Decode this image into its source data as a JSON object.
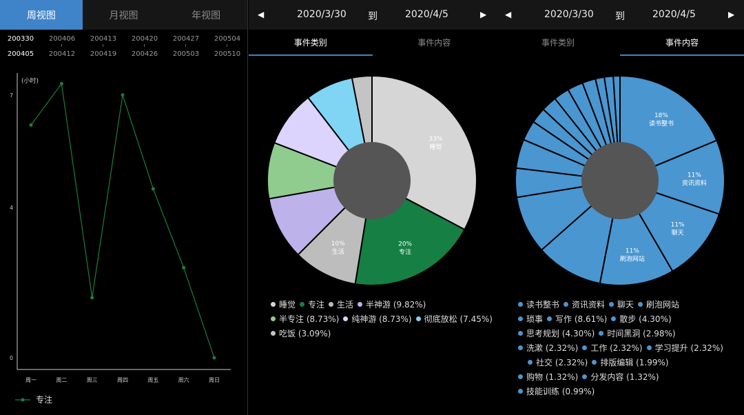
{
  "view_tabs": [
    "周视图",
    "月视图",
    "年视图"
  ],
  "weeks": [
    {
      "a": "200330",
      "b": "200405",
      "selected": true
    },
    {
      "a": "200406",
      "b": "200412"
    },
    {
      "a": "200413",
      "b": "200419"
    },
    {
      "a": "200420",
      "b": "200426"
    },
    {
      "a": "200427",
      "b": "200503"
    },
    {
      "a": "200504",
      "b": "200510"
    }
  ],
  "range": {
    "start": "2020/3/30",
    "to": "到",
    "end": "2020/4/5"
  },
  "sub_tabs": [
    "事件类别",
    "事件内容"
  ],
  "colors": {
    "accent": "#3f83c8",
    "focus": "#1a7f3f",
    "blue": "#4a96d0"
  },
  "chart_data": [
    {
      "type": "line",
      "ylabel": "(小时)",
      "categories": [
        "周一",
        "周二",
        "周三",
        "周四",
        "周五",
        "周六",
        "周日"
      ],
      "yticks": [
        0,
        4,
        7
      ],
      "ylim": [
        0,
        7.4
      ],
      "series": [
        {
          "name": "专注",
          "color": "#1a7f3f",
          "values": [
            6.2,
            7.3,
            1.6,
            7.0,
            4.5,
            2.4,
            0
          ]
        }
      ]
    },
    {
      "type": "pie",
      "donut": true,
      "slices": [
        {
          "label": "睡觉",
          "value": 33,
          "color": "#d6d6d6",
          "show": "33%"
        },
        {
          "label": "专注",
          "value": 20,
          "color": "#167f43",
          "show": "20%"
        },
        {
          "label": "生活",
          "value": 10,
          "color": "#bdbdbd",
          "show": "10%"
        },
        {
          "label": "半神游",
          "value": 9.82,
          "color": "#bdb2ea"
        },
        {
          "label": "半专注",
          "value": 8.73,
          "color": "#8fcc8d"
        },
        {
          "label": "纯神游",
          "value": 8.73,
          "color": "#dcd4fc"
        },
        {
          "label": "彻底放松",
          "value": 7.45,
          "color": "#80d4f4"
        },
        {
          "label": "吃饭",
          "value": 3.09,
          "color": "#c4c4c4"
        }
      ],
      "legend_rows": [
        [
          {
            "t": "睡觉",
            "c": "#d6d6d6"
          },
          {
            "t": "专注",
            "c": "#167f43"
          },
          {
            "t": "生活",
            "c": "#bdbdbd"
          },
          {
            "t": "半神游 (9.82%)",
            "c": "#bdb2ea"
          }
        ],
        [
          {
            "t": "半专注 (8.73%)",
            "c": "#8fcc8d"
          },
          {
            "t": "纯神游 (8.73%)",
            "c": "#dcd4fc"
          },
          {
            "t": "彻底放松 (7.45%)",
            "c": "#80d4f4"
          }
        ],
        [
          {
            "t": "吃饭 (3.09%)",
            "c": "#c4c4c4"
          }
        ]
      ]
    },
    {
      "type": "pie",
      "donut": true,
      "slices": [
        {
          "label": "读书整书",
          "value": 18,
          "show": "18%"
        },
        {
          "label": "资讯资料",
          "value": 11,
          "show": "11%"
        },
        {
          "label": "聊天",
          "value": 11,
          "show": "11%"
        },
        {
          "label": "刷泡网站",
          "value": 11,
          "show": "11%"
        },
        {
          "label": "琐事",
          "value": 10
        },
        {
          "label": "写作",
          "value": 8.61
        },
        {
          "label": "散步",
          "value": 4.3
        },
        {
          "label": "思考规划",
          "value": 4.3
        },
        {
          "label": "时间黑洞",
          "value": 2.98
        },
        {
          "label": "洗漱",
          "value": 2.32
        },
        {
          "label": "工作",
          "value": 2.32
        },
        {
          "label": "学习提升",
          "value": 2.32
        },
        {
          "label": "社交",
          "value": 2.32
        },
        {
          "label": "排版编辑",
          "value": 1.99
        },
        {
          "label": "购物",
          "value": 1.32
        },
        {
          "label": "分发内容",
          "value": 1.32
        },
        {
          "label": "技能训练",
          "value": 0.99
        }
      ],
      "legend_rows": [
        [
          "读书整书",
          "资讯资料",
          "聊天",
          "刷泡网站"
        ],
        [
          "琐事",
          "写作 (8.61%)",
          "散步 (4.30%)"
        ],
        [
          "思考规划 (4.30%)",
          "时间黑洞 (2.98%)"
        ],
        [
          "洗漱 (2.32%)",
          "工作 (2.32%)",
          "学习提升 (2.32%)"
        ],
        [
          "社交 (2.32%)",
          "排版编辑 (1.99%)"
        ],
        [
          "购物 (1.32%)",
          "分发内容 (1.32%)"
        ],
        [
          "技能训练 (0.99%)"
        ]
      ]
    }
  ]
}
